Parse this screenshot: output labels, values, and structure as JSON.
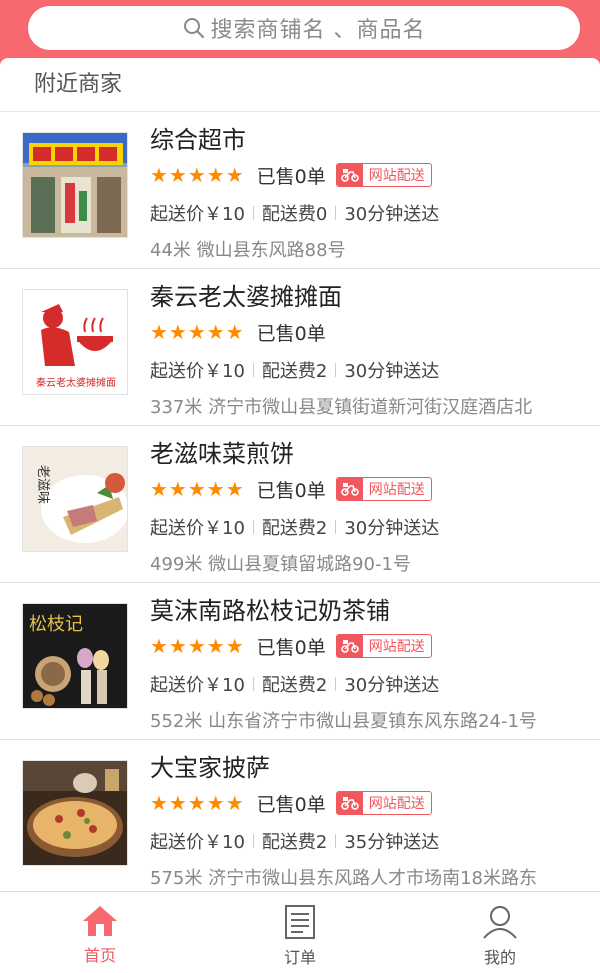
{
  "search": {
    "placeholder": "搜索商铺名 、商品名"
  },
  "section": {
    "title": "附近商家"
  },
  "shops": [
    {
      "name": "综合超市",
      "stars": "★★★★★",
      "sold": "已售0单",
      "badge": "网站配送",
      "min_price": "起送价￥10",
      "delivery_fee": "配送费0",
      "eta": "30分钟送达",
      "address": "44米  微山县东风路88号"
    },
    {
      "name": "秦云老太婆摊摊面",
      "stars": "★★★★★",
      "sold": "已售0单",
      "badge": "",
      "min_price": "起送价￥10",
      "delivery_fee": "配送费2",
      "eta": "30分钟送达",
      "address": "337米  济宁市微山县夏镇街道新河街汉庭酒店北"
    },
    {
      "name": "老滋味菜煎饼",
      "stars": "★★★★★",
      "sold": "已售0单",
      "badge": "网站配送",
      "min_price": "起送价￥10",
      "delivery_fee": "配送费2",
      "eta": "30分钟送达",
      "address": "499米  微山县夏镇留城路90-1号"
    },
    {
      "name": "莫沫南路松枝记奶茶铺",
      "stars": "★★★★★",
      "sold": "已售0单",
      "badge": "网站配送",
      "min_price": "起送价￥10",
      "delivery_fee": "配送费2",
      "eta": "30分钟送达",
      "address": "552米  山东省济宁市微山县夏镇东风东路24-1号"
    },
    {
      "name": "大宝家披萨",
      "stars": "★★★★★",
      "sold": "已售0单",
      "badge": "网站配送",
      "min_price": "起送价￥10",
      "delivery_fee": "配送费2",
      "eta": "35分钟送达",
      "address": "575米  济宁市微山县东风路人才市场南18米路东"
    }
  ],
  "thumb_texts": {
    "qinyun": "秦云老太婆摊摊面",
    "laoziwei": "老滋味",
    "songzhiji": "松枝记"
  },
  "tabs": [
    {
      "label": "首页",
      "icon": "home-icon"
    },
    {
      "label": "订单",
      "icon": "order-icon"
    },
    {
      "label": "我的",
      "icon": "user-icon"
    }
  ],
  "colors": {
    "accent": "#f7696f",
    "star": "#ff8a00",
    "badge": "#f0585e"
  }
}
